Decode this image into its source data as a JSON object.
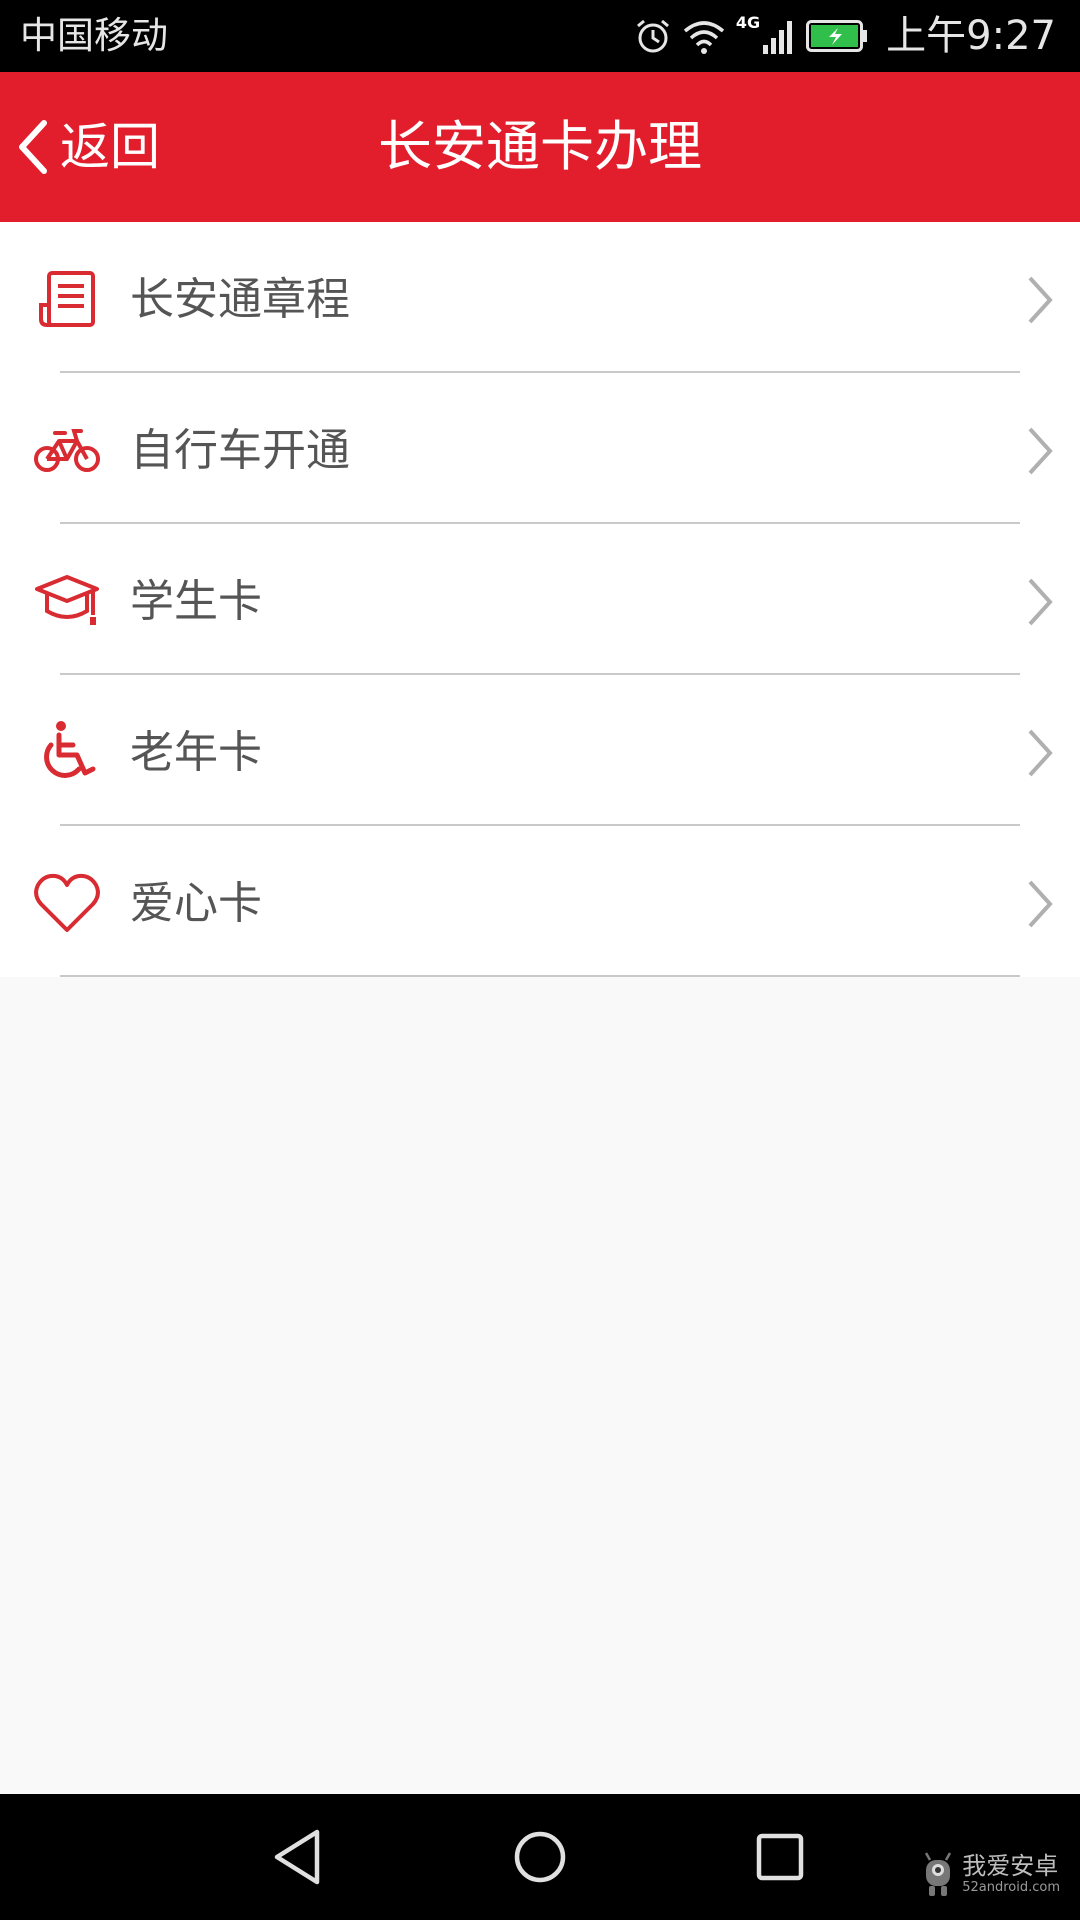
{
  "status_bar": {
    "carrier": "中国移动",
    "network": "4G",
    "time": "上午9:27"
  },
  "header": {
    "back_label": "返回",
    "title": "长安通卡办理"
  },
  "menu": {
    "items": [
      {
        "label": "长安通章程",
        "icon": "document-icon"
      },
      {
        "label": "自行车开通",
        "icon": "bicycle-icon"
      },
      {
        "label": "学生卡",
        "icon": "graduation-cap-icon"
      },
      {
        "label": "老年卡",
        "icon": "wheelchair-icon"
      },
      {
        "label": "爱心卡",
        "icon": "heart-icon"
      }
    ]
  },
  "watermark": {
    "main": "我爱安卓",
    "sub": "52android.com"
  },
  "colors": {
    "accent": "#e21e2d",
    "icon_red": "#d92b32",
    "label_gray": "#555555",
    "divider": "#c9c9c9",
    "chevron": "#b0b0b0"
  }
}
